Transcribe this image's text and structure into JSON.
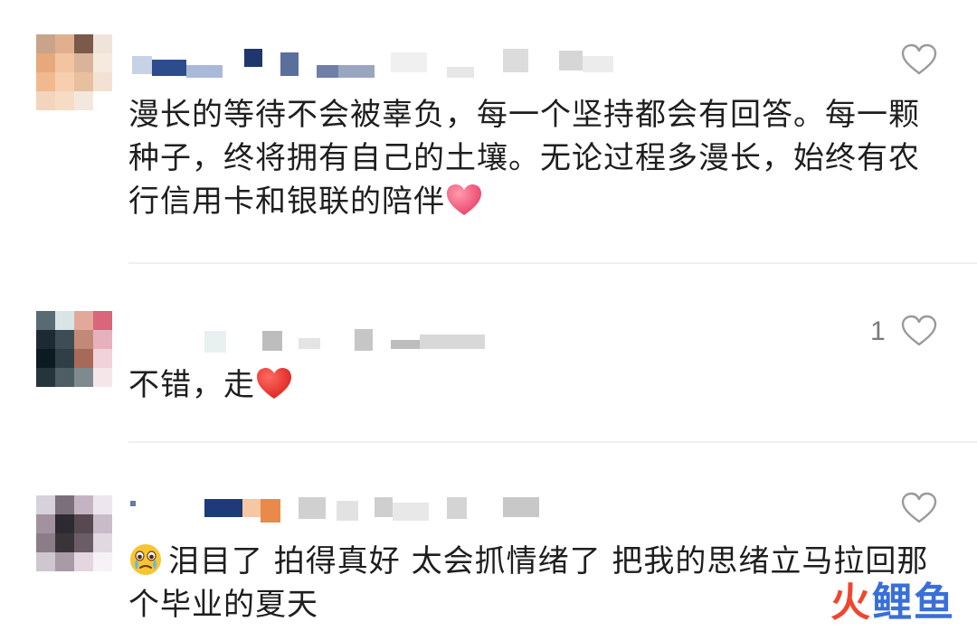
{
  "comments": [
    {
      "text": "漫长的等待不会被辜负，每一个坚持都会有回答。每一颗种子，终将拥有自己的土壤。无论过程多漫长，始终有农行信用卡和银联的陪伴",
      "like_count": "",
      "emoji": "pink-heart"
    },
    {
      "text": "不错，走",
      "like_count": "1",
      "emoji": "red-heart"
    },
    {
      "text": "泪目了 拍得真好 太会抓情绪了 把我的思绪立马拉回那个毕业的夏天",
      "like_count": "",
      "emoji": "teary-face"
    }
  ],
  "watermark": {
    "part1": "火",
    "part2": "鲤鱼"
  },
  "colors": {
    "heart_outline": "#9a9a9a",
    "pink_heart": "#f0506e",
    "red_heart": "#e8322a",
    "divider": "#efefef"
  }
}
